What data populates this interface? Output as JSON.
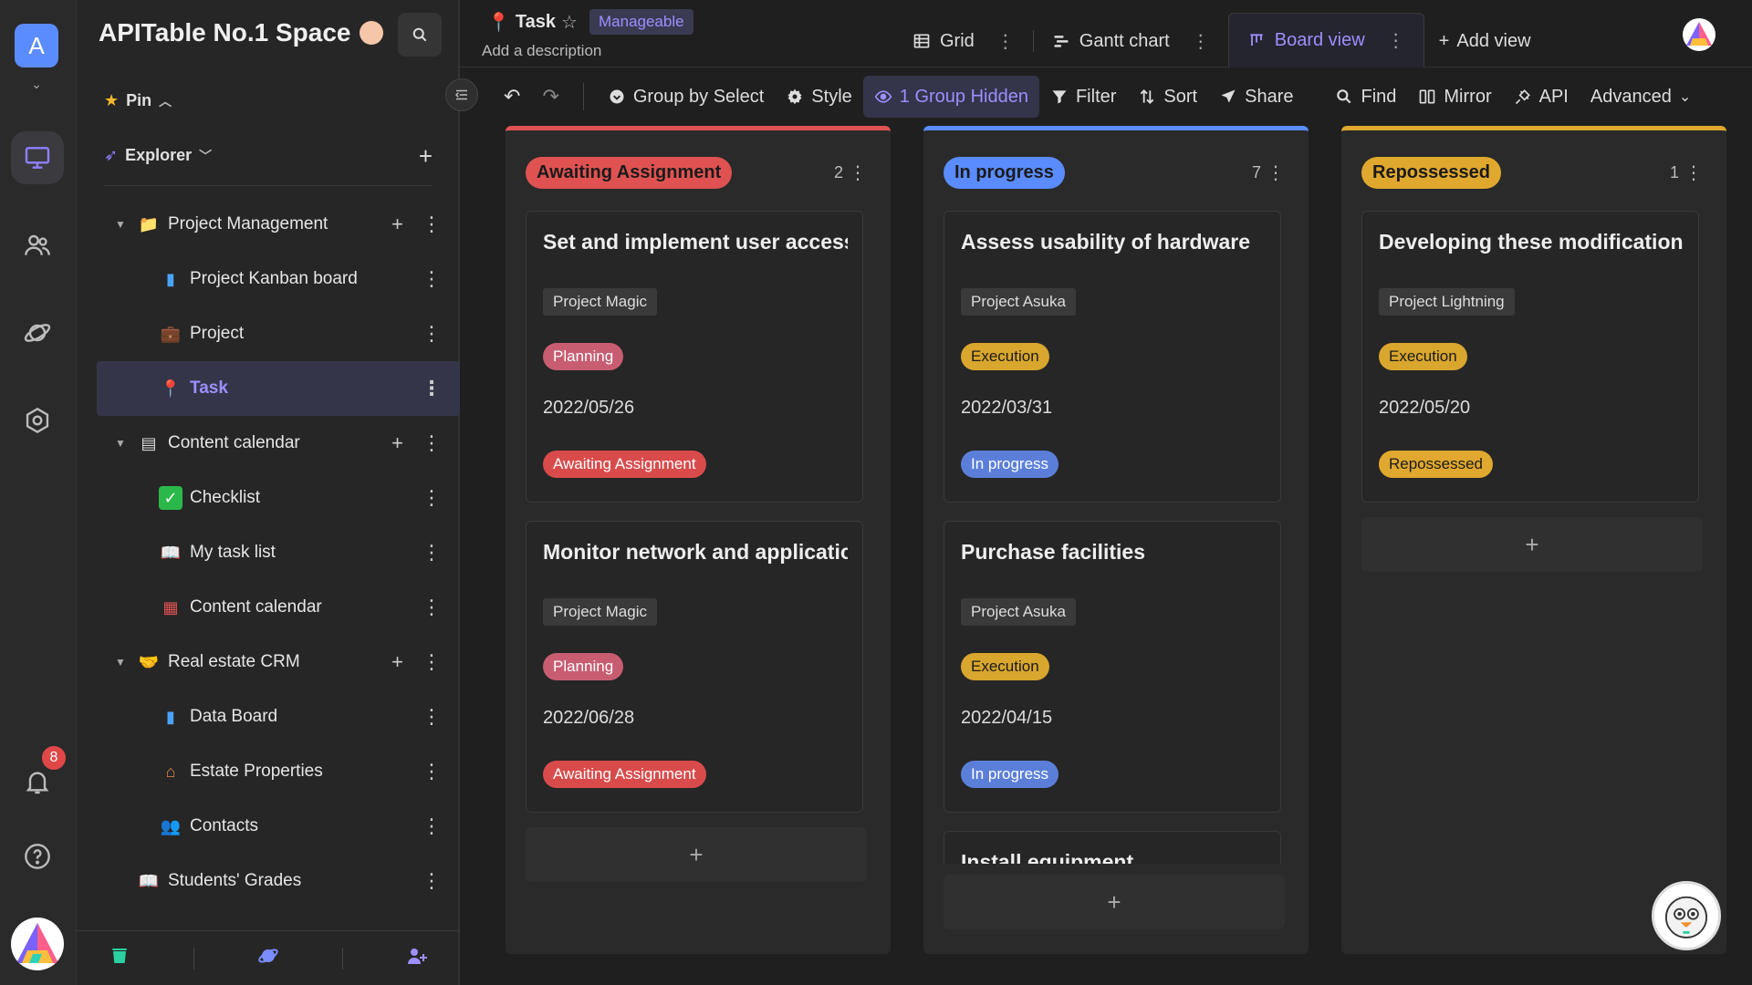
{
  "rail": {
    "workspace_letter": "A",
    "notification_count": "8"
  },
  "sidebar": {
    "space_name": "APITable No.1 Space",
    "pin_label": "Pin",
    "explorer_label": "Explorer",
    "tree": [
      {
        "label": "Project Management",
        "kind": "folder",
        "icon": "folder-icon"
      },
      {
        "label": "Project Kanban board",
        "kind": "child",
        "icon": "bar-chart-icon"
      },
      {
        "label": "Project",
        "kind": "child",
        "icon": "briefcase-icon"
      },
      {
        "label": "Task",
        "kind": "child-active",
        "icon": "pin-icon"
      },
      {
        "label": "Content calendar",
        "kind": "folder",
        "icon": "note-icon"
      },
      {
        "label": "Checklist",
        "kind": "child",
        "icon": "check-icon"
      },
      {
        "label": "My task list",
        "kind": "child",
        "icon": "book-icon"
      },
      {
        "label": "Content calendar",
        "kind": "child",
        "icon": "calendar-icon"
      },
      {
        "label": "Real estate CRM",
        "kind": "folder",
        "icon": "handshake-icon"
      },
      {
        "label": "Data Board",
        "kind": "child",
        "icon": "bar-chart-icon"
      },
      {
        "label": "Estate Properties",
        "kind": "child",
        "icon": "house-icon"
      },
      {
        "label": "Contacts",
        "kind": "child",
        "icon": "people-icon"
      },
      {
        "label": "Students' Grades",
        "kind": "root",
        "icon": "book-icon"
      }
    ]
  },
  "header": {
    "title": "Task",
    "permission_tag": "Manageable",
    "description": "Add a description",
    "views": [
      {
        "label": "Grid",
        "icon": "grid-icon"
      },
      {
        "label": "Gantt chart",
        "icon": "gantt-icon"
      },
      {
        "label": "Board view",
        "icon": "board-icon",
        "active": true
      }
    ],
    "add_view_label": "Add view"
  },
  "toolbar": {
    "group_by": "Group by Select",
    "style": "Style",
    "hidden": "1 Group Hidden",
    "filter": "Filter",
    "sort": "Sort",
    "share": "Share",
    "find": "Find",
    "mirror": "Mirror",
    "api": "API",
    "advanced": "Advanced"
  },
  "board": {
    "columns": [
      {
        "name": "Awaiting Assignment",
        "count": "2",
        "color": "#e05252",
        "cards": [
          {
            "title": "Set and implement user access",
            "project": "Project Magic",
            "phase": "Planning",
            "date": "2022/05/26",
            "status": "Awaiting Assignment"
          },
          {
            "title": "Monitor network and application",
            "project": "Project Magic",
            "phase": "Planning",
            "date": "2022/06/28",
            "status": "Awaiting Assignment"
          }
        ]
      },
      {
        "name": "In progress",
        "count": "7",
        "color": "#5b8cff",
        "cards": [
          {
            "title": "Assess usability of hardware",
            "project": "Project Asuka",
            "phase": "Execution",
            "date": "2022/03/31",
            "status": "In progress"
          },
          {
            "title": "Purchase facilities",
            "project": "Project Asuka",
            "phase": "Execution",
            "date": "2022/04/15",
            "status": "In progress"
          }
        ],
        "peek_title": "Install equipment"
      },
      {
        "name": "Repossessed",
        "count": "1",
        "color": "#e0a82e",
        "cards": [
          {
            "title": "Developing these modifications",
            "project": "Project Lightning",
            "phase": "Execution",
            "date": "2022/05/20",
            "status": "Repossessed"
          }
        ]
      }
    ]
  },
  "colors": {
    "accent": "#9d8fff",
    "awaiting": "#e05252",
    "in_progress": "#5b8cff",
    "repossessed": "#e0a82e",
    "planning": "#c85d72"
  }
}
